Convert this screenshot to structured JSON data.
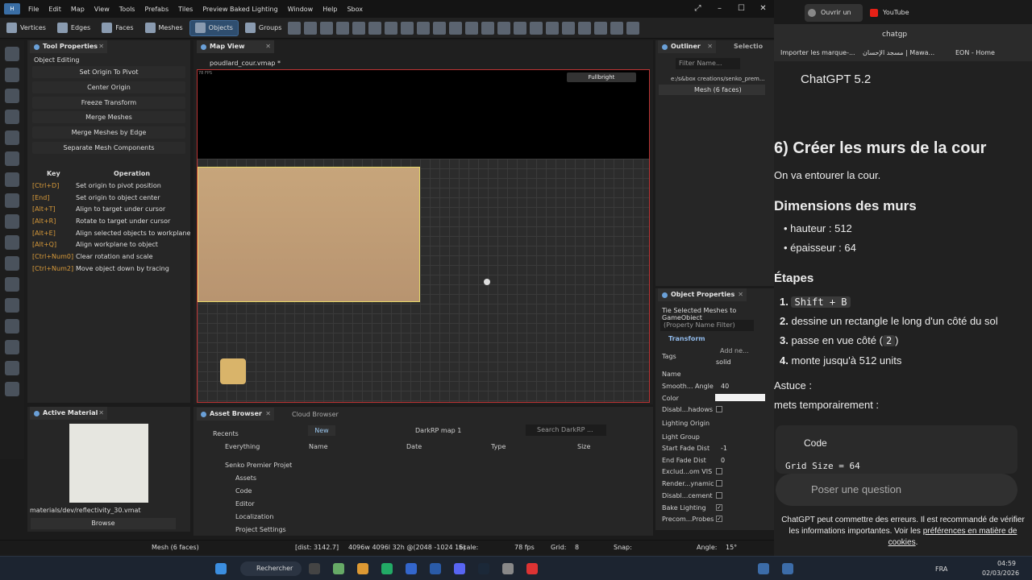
{
  "menu": [
    "File",
    "Edit",
    "Map",
    "View",
    "Tools",
    "Prefabs",
    "Tiles",
    "Preview Baked Lighting",
    "Window",
    "Help",
    "Sbox"
  ],
  "modes": [
    "Vertices",
    "Edges",
    "Faces",
    "Meshes",
    "Objects",
    "Groups"
  ],
  "tool_properties": {
    "tab": "Tool Properties",
    "section": "Object Editing",
    "buttons": [
      "Set Origin To Pivot",
      "Center Origin",
      "Freeze Transform",
      "Merge Meshes",
      "Merge Meshes by Edge",
      "Separate Mesh Components"
    ],
    "key_header": "Key",
    "op_header": "Operation",
    "shortcuts": [
      {
        "k": "[Ctrl+D]",
        "o": "Set origin to pivot position"
      },
      {
        "k": "[End]",
        "o": "Set origin to object center"
      },
      {
        "k": "[Alt+T]",
        "o": "Align to target under cursor"
      },
      {
        "k": "[Alt+R]",
        "o": "Rotate to target under cursor"
      },
      {
        "k": "[Alt+E]",
        "o": "Align selected objects to workplane"
      },
      {
        "k": "[Alt+Q]",
        "o": "Align workplane to object"
      },
      {
        "k": "[Ctrl+Num0]",
        "o": "Clear rotation and scale"
      },
      {
        "k": "[Ctrl+Num2]",
        "o": "Move object down by tracing"
      }
    ]
  },
  "mapview": {
    "tab": "Map View",
    "file": "poudlard_cour.vmap *",
    "fps_small": "78 FPS",
    "fullbright": "Fullbright"
  },
  "outliner": {
    "tab": "Outliner",
    "tab2": "Selectio",
    "filter": "Filter Name...",
    "path": "e:/s&box creations/senko_prem...",
    "item": "Mesh (6 faces)"
  },
  "object_properties": {
    "tab": "Object Properties",
    "tie": "Tie Selected Meshes to GameObject",
    "filter": "(Property Name Filter)",
    "transform": "Transform",
    "add": "Add ne...",
    "tags_value": "solid",
    "labels": [
      "Tags",
      "Name",
      "Smooth... Angle",
      "Color",
      "Disabl...hadows",
      "Lighting Origin",
      "Light Group",
      "Start Fade Dist",
      "End Fade Dist",
      "Exclud...om VIS",
      "Render...ynamic",
      "Disabl...cement",
      "Bake Lighting",
      "Precom...Probes"
    ],
    "smooth": "40",
    "start_fade": "-1",
    "end_fade": "0"
  },
  "active_material": {
    "tab": "Active Material",
    "path": "materials/dev/reflectivity_30.vmat",
    "browse": "Browse"
  },
  "asset_browser": {
    "tab": "Asset Browser",
    "tab2": "Cloud Browser",
    "new": "New",
    "crumb": "DarkRP map 1",
    "search": "Search DarkRP ...",
    "tree": [
      "Recents",
      "Everything",
      "Senko Premier Projet",
      "Assets",
      "Code",
      "Editor",
      "Localization",
      "Project Settings"
    ],
    "cols": [
      "Name",
      "Date",
      "Type",
      "Size"
    ]
  },
  "status": {
    "sel": "Mesh (6 faces)",
    "dist": "[dist: 3142.7]",
    "dims": "4096w 4096l 32h @(2048 -1024 16)",
    "scale": "Scale:",
    "fps": "78 fps",
    "grid": "Grid:",
    "grid_val": "8",
    "snap": "Snap:",
    "angle": "Angle:",
    "angle_val": "15°"
  },
  "browser": {
    "tab1": "Ouvrir un",
    "tab2": "YouTube",
    "url": "chatgp",
    "bookmarks": [
      "Importer les marque-...",
      "مسجد الإحسان | Mawa...",
      "EON - Home"
    ]
  },
  "chat": {
    "model": "ChatGPT 5.2",
    "h1": "6) Créer les murs de la cour",
    "p1": "On va entourer la cour.",
    "h2": "Dimensions des murs",
    "bullets": [
      "hauteur : 512",
      "épaisseur : 64"
    ],
    "h3": "Étapes",
    "steps": [
      {
        "n": "1.",
        "pre": "",
        "code": "Shift + B",
        "post": ""
      },
      {
        "n": "2.",
        "pre": "dessine un rectangle le long d'un côté du sol",
        "code": "",
        "post": ""
      },
      {
        "n": "3.",
        "pre": "passe en vue côté (",
        "code": "2",
        "post": ")"
      },
      {
        "n": "4.",
        "pre": "monte jusqu'à 512 units",
        "code": "",
        "post": ""
      }
    ],
    "astuce": "Astuce :",
    "mets": "mets temporairement :",
    "code_label": "Code",
    "code_line": "Grid Size = 64",
    "placeholder": "Poser une question",
    "disclaimer1": "ChatGPT peut commettre des erreurs. Il est recommandé de vérifier",
    "disclaimer2": "les informations importantes. Voir les ",
    "disclaimer_link": "préférences en matière de",
    "disclaimer3": "cookies",
    "disclaimer_end": "."
  },
  "taskbar": {
    "search": "Rechercher",
    "lang": "FRA",
    "time": "04:59",
    "date": "02/03/2026"
  }
}
